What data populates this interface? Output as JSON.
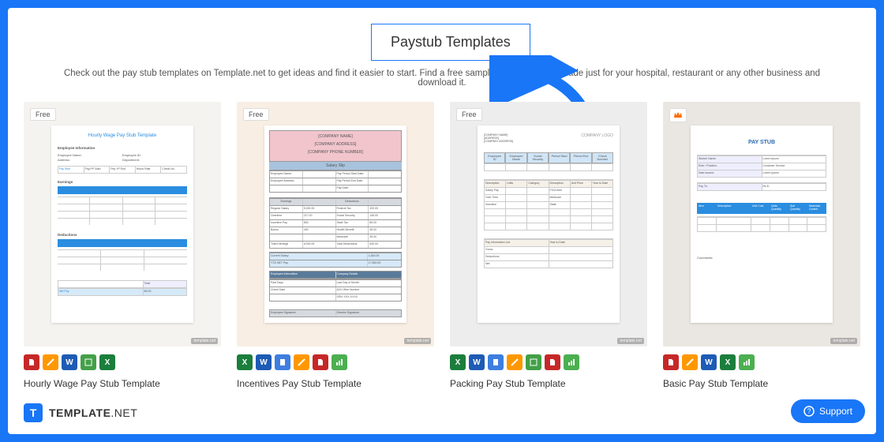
{
  "heading": "Paystub Templates",
  "description": "Check out the pay stub templates on Template.net to get ideas and find it easier to start. Find a free sample pay stub that is made just for your hospital, restaurant or any other business and download it.",
  "badges": {
    "free": "Free"
  },
  "cards": [
    {
      "title": "Hourly Wage Pay Stub Template",
      "docHeading": "Hourly Wage Pay Stub Template",
      "section1": "Employee Information",
      "earningsLabel": "Earnings",
      "deductionsLabel": "Deductions",
      "netPay": "Net Pay",
      "total": "Total",
      "amount": "$0.00"
    },
    {
      "title": "Incentives Pay Stub Template",
      "company": "[COMPANY NAME]",
      "addr": "[COMPANY ADDRESS]",
      "phone": "[COMPANY PHONE NUMBER]",
      "salarySlip": "Salary Slip",
      "earnings": "Earnings",
      "deductions": "Deductions",
      "employeeInfo": "Employee Information",
      "companyDetail": "Company Details"
    },
    {
      "title": "Packing Pay Stub Template",
      "logo": "COMPANY LOGO",
      "tabs": [
        "Employee ID",
        "Employee Name",
        "Social Security",
        "Period Start",
        "Period End",
        "Check Number"
      ],
      "sectionA": "Pay Information List",
      "sectionB": "Year to Date"
    },
    {
      "title": "Basic Pay Stub Template",
      "heading": "PAY STUB",
      "payto": "Pay To:",
      "headers": [
        "Item",
        "Description",
        "Unit Cost",
        "Units Quantity",
        "Sub Quantity",
        "Materials Contrib"
      ]
    }
  ],
  "brand": {
    "name": "TEMPLATE",
    "suffix": ".NET"
  },
  "support": "Support",
  "miniLabel": "template.net"
}
